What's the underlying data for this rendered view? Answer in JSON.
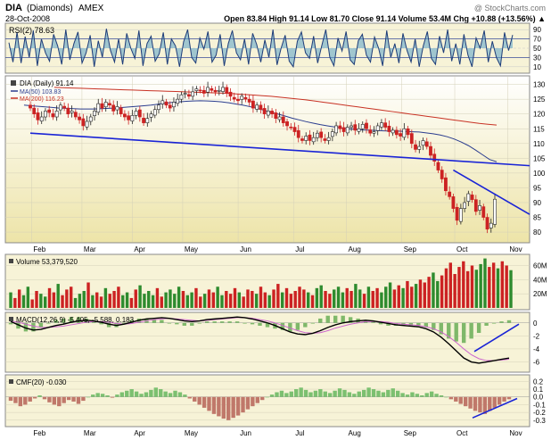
{
  "header": {
    "symbol": "DIA",
    "name": "(Diamonds)",
    "exchange": "AMEX",
    "date": "28-Oct-2008",
    "watermark": "@ StockCharts.com",
    "stats": "Open 83.84  High 91.14  Low 81.70  Close 91.14  Volume 53.4M  Chg +10.88 (+13.56%) ▲"
  },
  "colors": {
    "panel_bg": "#f7f3d7",
    "price_bg_top": "#ffffff",
    "price_bg_bottom": "#ede4a8",
    "up": "#2e8b2e",
    "down": "#cc2222",
    "rsi_fill": "#5aa0c8",
    "ma50": "#2b3d8f",
    "ma200": "#c83224",
    "trendline": "#1a24d6",
    "macd": "#000000",
    "signal": "#cc66cc",
    "hist": "#7fb86a",
    "cmf_pos": "#7cc070",
    "cmf_neg": "#c0786a"
  },
  "rsi": {
    "label": "RSI(2) 78.63",
    "ticks": [
      "90",
      "70",
      "50",
      "30",
      "10"
    ],
    "values": [
      62,
      20,
      85,
      18,
      75,
      30,
      88,
      12,
      70,
      40,
      22,
      80,
      55,
      15,
      90,
      25,
      60,
      85,
      18,
      40,
      78,
      10,
      66,
      30,
      92,
      45,
      20,
      70,
      15,
      82,
      50,
      28,
      88,
      12,
      60,
      76,
      22,
      38,
      84,
      15,
      70,
      55,
      10,
      64,
      90,
      30,
      18,
      72,
      48,
      86,
      20,
      35,
      80,
      12,
      60,
      88,
      40,
      25,
      70,
      15,
      82,
      58,
      20,
      68,
      30,
      90,
      14,
      50,
      78,
      22,
      10,
      65,
      85,
      40,
      28,
      76,
      18,
      55,
      90,
      30,
      12,
      72,
      44,
      86,
      25,
      15,
      66,
      80,
      35,
      20,
      74,
      50,
      12,
      88,
      30,
      60,
      18,
      82,
      45,
      20,
      70,
      10,
      55,
      86,
      28,
      15,
      76,
      40,
      90,
      22,
      60,
      15,
      80,
      35,
      10,
      72,
      50,
      88,
      20,
      65,
      30,
      12,
      84,
      45,
      78.63
    ]
  },
  "chart_data": [
    {
      "type": "candlestick",
      "title": "DIA (Daily) 91.14",
      "legend": [
        "MA(50) 103.83",
        "MA(200) 116.23"
      ],
      "x_ticks": [
        "Feb",
        "Mar",
        "Apr",
        "May",
        "Jun",
        "Jul",
        "Aug",
        "Sep",
        "Oct",
        "Nov"
      ],
      "y_ticks": [
        130,
        125,
        120,
        115,
        110,
        105,
        100,
        95,
        90,
        85,
        80
      ],
      "ylim": [
        77,
        132
      ],
      "close": [
        122,
        120,
        118,
        119,
        121,
        120.5,
        119,
        121,
        123,
        122,
        120,
        121,
        119,
        118,
        116,
        117.5,
        119,
        121,
        123.5,
        122,
        124,
        123,
        121,
        122.5,
        120,
        119,
        118,
        119.5,
        121,
        119,
        117,
        118.5,
        120,
        121.5,
        123,
        124.5,
        123,
        122,
        124,
        125,
        126.5,
        127,
        126,
        127.5,
        128.5,
        128,
        127,
        129,
        128,
        127.5,
        128,
        129,
        127,
        126,
        125,
        124.5,
        126,
        125,
        124,
        122,
        123,
        121.5,
        120,
        121,
        120,
        118.5,
        119,
        117,
        116,
        115.5,
        114,
        112,
        111,
        112.5,
        111,
        112,
        113.5,
        112,
        111,
        112,
        114,
        116,
        115,
        114,
        115.5,
        116,
        114.5,
        115,
        116.5,
        115,
        113.5,
        114,
        116,
        117,
        115.5,
        114,
        114.5,
        113,
        112.5,
        115,
        113,
        110,
        108,
        109,
        111,
        109,
        106,
        104,
        101,
        98,
        94,
        92,
        88,
        84,
        88,
        90,
        93,
        91,
        87,
        89,
        85,
        81,
        83,
        91.14
      ],
      "ma50": [
        123,
        122.8,
        122.6,
        122.4,
        122.2,
        122,
        121.9,
        121.8,
        121.7,
        121.7,
        121.7,
        121.8,
        121.9,
        122,
        122.2,
        122.4,
        122.6,
        122.8,
        123,
        123.3,
        123.6,
        123.9,
        124.1,
        124.3,
        124.4,
        124.5,
        124.4,
        124.3,
        124.1,
        123.8,
        123.4,
        123,
        122.5,
        121.9,
        121.3,
        120.6,
        120,
        119.3,
        118.6,
        118,
        117.4,
        116.9,
        116.4,
        116,
        115.6,
        115.3,
        115,
        114.8,
        114.6,
        114.5,
        114.4,
        114.3,
        114.2,
        114.2,
        114.1,
        114,
        113.9,
        113.6,
        113.3,
        112.9,
        112.3,
        111.5,
        110.5,
        109.3,
        107.8,
        106.2,
        104.6,
        103.83
      ],
      "ma200": [
        129,
        128.9,
        128.8,
        128.7,
        128.6,
        128.5,
        128.4,
        128.3,
        128.2,
        128.1,
        128,
        127.9,
        127.8,
        127.7,
        127.6,
        127.5,
        127.4,
        127.3,
        127.2,
        127.1,
        127,
        126.8,
        126.6,
        126.4,
        126.2,
        126,
        125.7,
        125.4,
        125.1,
        124.8,
        124.4,
        124,
        123.6,
        123.2,
        122.8,
        122.4,
        122,
        121.6,
        121.2,
        120.8,
        120.4,
        120,
        119.6,
        119.2,
        118.8,
        118.4,
        118,
        117.6,
        117.2,
        116.8,
        116.5,
        116.23
      ]
    },
    {
      "type": "bar",
      "title": "Volume 53,379,520",
      "y_ticks": [
        "60M",
        "40M",
        "20M"
      ],
      "ylim": [
        0,
        72
      ],
      "values_m": [
        22,
        14,
        26,
        18,
        30,
        12,
        24,
        20,
        16,
        28,
        22,
        34,
        18,
        26,
        30,
        14,
        20,
        24,
        36,
        18,
        22,
        16,
        28,
        20,
        24,
        30,
        18,
        22,
        14,
        26,
        32,
        20,
        24,
        18,
        28,
        16,
        22,
        26,
        20,
        30,
        24,
        18,
        22,
        28,
        16,
        20,
        26,
        22,
        30,
        18,
        24,
        20,
        28,
        22,
        16,
        26,
        24,
        20,
        30,
        22,
        18,
        26,
        34,
        22,
        28,
        20,
        24,
        30,
        26,
        22,
        18,
        28,
        32,
        24,
        20,
        26,
        30,
        22,
        28,
        24,
        34,
        26,
        20,
        30,
        24,
        28,
        22,
        30,
        36,
        26,
        32,
        28,
        38,
        30,
        34,
        40,
        36,
        44,
        50,
        38,
        46,
        56,
        64,
        48,
        58,
        66,
        52,
        60,
        54,
        62,
        70,
        58,
        64,
        56,
        66,
        60,
        53.4
      ]
    },
    {
      "type": "line",
      "title": "MACD(12,26,9) -5.405, -5.588, 0.183",
      "y_ticks": [
        "0",
        "-2",
        "-4",
        "-6"
      ],
      "ylim": [
        -7.3,
        1.2
      ],
      "macd": [
        0.2,
        -0.3,
        -0.8,
        -1.1,
        -1.0,
        -0.7,
        -0.4,
        -0.2,
        0.1,
        0.3,
        0.4,
        0.3,
        0.1,
        -0.2,
        -0.4,
        -0.2,
        0.1,
        0.4,
        0.6,
        0.7,
        0.8,
        0.7,
        0.5,
        0.3,
        0.2,
        0.3,
        0.5,
        0.6,
        0.7,
        0.8,
        0.9,
        0.8,
        0.6,
        0.3,
        0.0,
        -0.4,
        -0.9,
        -1.4,
        -1.7,
        -1.8,
        -1.6,
        -1.2,
        -0.7,
        -0.3,
        0.0,
        0.2,
        0.3,
        0.4,
        0.3,
        0.1,
        -0.1,
        -0.3,
        -0.4,
        -0.5,
        -0.6,
        -0.9,
        -1.4,
        -2.2,
        -3.2,
        -4.3,
        -5.4,
        -6.0,
        -6.2,
        -6.0,
        -5.8,
        -5.6,
        -5.405
      ],
      "signal": [
        0.3,
        0.1,
        -0.2,
        -0.5,
        -0.7,
        -0.7,
        -0.6,
        -0.5,
        -0.3,
        -0.1,
        0.1,
        0.2,
        0.2,
        0.1,
        -0.1,
        -0.2,
        -0.1,
        0.1,
        0.3,
        0.5,
        0.6,
        0.7,
        0.6,
        0.5,
        0.4,
        0.3,
        0.4,
        0.5,
        0.6,
        0.7,
        0.8,
        0.8,
        0.7,
        0.5,
        0.3,
        0.0,
        -0.4,
        -0.8,
        -1.2,
        -1.5,
        -1.6,
        -1.5,
        -1.2,
        -0.8,
        -0.5,
        -0.2,
        0.0,
        0.2,
        0.2,
        0.2,
        0.1,
        -0.1,
        -0.2,
        -0.3,
        -0.4,
        -0.6,
        -0.9,
        -1.4,
        -2.1,
        -3.0,
        -4.0,
        -4.9,
        -5.5,
        -5.8,
        -5.8,
        -5.7,
        -5.588
      ],
      "trendline_note": "rising trendline on MACD"
    },
    {
      "type": "bar",
      "title": "CMF(20) -0.030",
      "y_ticks": [
        "0.2",
        "0.1",
        "0.0",
        "-0.1",
        "-0.2",
        "-0.3"
      ],
      "ylim": [
        -0.36,
        0.25
      ],
      "values": [
        -0.05,
        -0.08,
        -0.12,
        -0.1,
        -0.06,
        -0.02,
        0.02,
        -0.03,
        -0.07,
        -0.1,
        -0.12,
        -0.08,
        -0.04,
        -0.06,
        -0.09,
        -0.05,
        0.0,
        0.03,
        0.05,
        0.04,
        0.02,
        -0.01,
        0.03,
        0.06,
        0.08,
        0.1,
        0.07,
        0.04,
        0.06,
        0.09,
        0.12,
        0.1,
        0.07,
        0.05,
        0.08,
        0.06,
        0.03,
        -0.02,
        -0.06,
        -0.1,
        -0.14,
        -0.18,
        -0.22,
        -0.25,
        -0.28,
        -0.3,
        -0.27,
        -0.24,
        -0.2,
        -0.16,
        -0.12,
        -0.08,
        -0.04,
        0.0,
        0.03,
        0.06,
        0.08,
        0.05,
        0.07,
        0.1,
        0.12,
        0.09,
        0.06,
        0.08,
        0.1,
        0.07,
        0.05,
        0.08,
        0.11,
        0.09,
        0.06,
        0.04,
        0.07,
        0.09,
        0.12,
        0.1,
        0.08,
        0.06,
        0.09,
        0.11,
        0.08,
        0.05,
        0.03,
        0.06,
        0.04,
        0.02,
        0.05,
        0.07,
        0.04,
        0.02,
        0.0,
        -0.03,
        -0.06,
        -0.09,
        -0.12,
        -0.15,
        -0.18,
        -0.2,
        -0.22,
        -0.18,
        -0.14,
        -0.1,
        -0.06,
        -0.03
      ]
    }
  ]
}
